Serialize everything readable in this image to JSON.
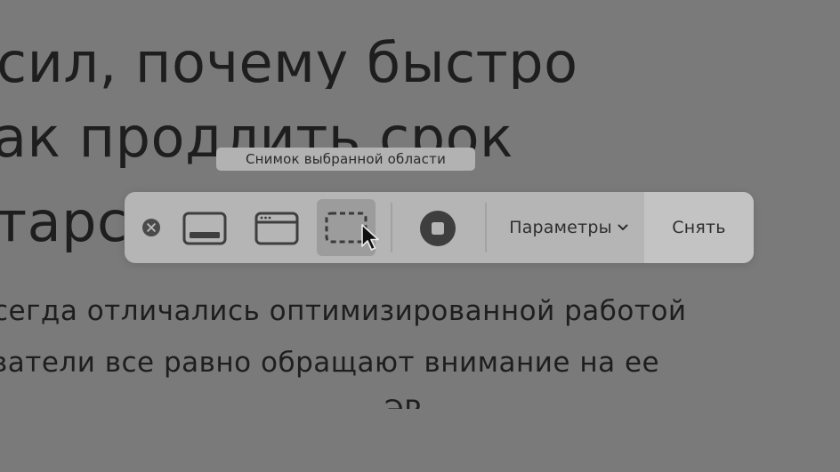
{
  "background": {
    "headline_lines": [
      "сил, почему быстро",
      "ак продлить срок",
      "тарс"
    ],
    "body_lines": [
      "сегда отличались оптимизированной работой",
      "ватели все равно обращают внимание на ее",
      "ЭР"
    ]
  },
  "tooltip": {
    "text": "Снимок выбранной области"
  },
  "toolbar": {
    "options_label": "Параметры",
    "capture_label": "Снять"
  },
  "icons": {
    "close": "close-icon",
    "capture_screen": "capture-entire-screen-icon",
    "capture_window": "capture-window-icon",
    "capture_selection": "capture-selection-icon",
    "record": "record-icon",
    "chevron": "chevron-down-icon",
    "cursor": "mouse-cursor-icon"
  }
}
